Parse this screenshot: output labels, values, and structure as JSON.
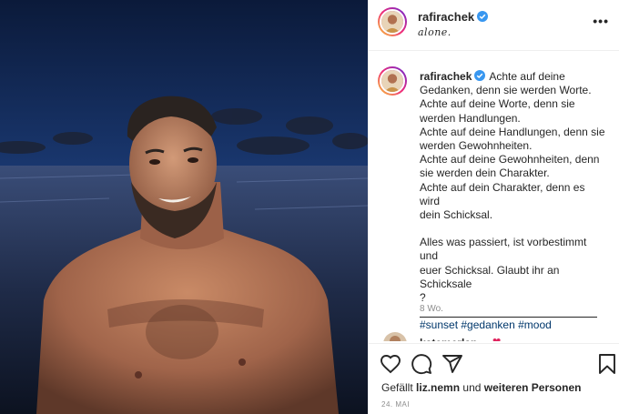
{
  "post": {
    "username": "rafirachek",
    "location": "alone.",
    "more_icon": "•••",
    "verified_icon": "verified-badge"
  },
  "caption": {
    "username": "rafirachek",
    "lines": [
      "Achte auf deine",
      "Gedanken, denn sie werden Worte.",
      "Achte auf deine Worte, denn sie",
      "werden Handlungen.",
      "Achte auf deine Handlungen, denn sie",
      "werden Gewohnheiten.",
      "Achte auf deine Gewohnheiten, denn",
      "sie werden dein Charakter.",
      "Achte auf dein Charakter, denn es wird",
      "dein Schicksal."
    ],
    "paragraph2": [
      "Alles was passiert, ist vorbestimmt und",
      "euer Schicksal. Glaubt ihr an Schicksale",
      "?"
    ],
    "hashtags": [
      "#sunset",
      "#gedanken",
      "#mood"
    ],
    "time_ago": "8 Wo."
  },
  "next_comment": {
    "username": "katemerlan",
    "heart": "❤"
  },
  "actions": {
    "like_icon": "heart-icon",
    "comment_icon": "comment-icon",
    "share_icon": "share-icon",
    "save_icon": "bookmark-icon"
  },
  "likes": {
    "prefix": "Gefällt",
    "user": "liz.nemn",
    "middle": "und",
    "others": "weiteren Personen"
  },
  "date": "24. MAI",
  "colors": {
    "link": "#00376b",
    "muted": "#8e8e8e",
    "verified": "#3897f0"
  }
}
